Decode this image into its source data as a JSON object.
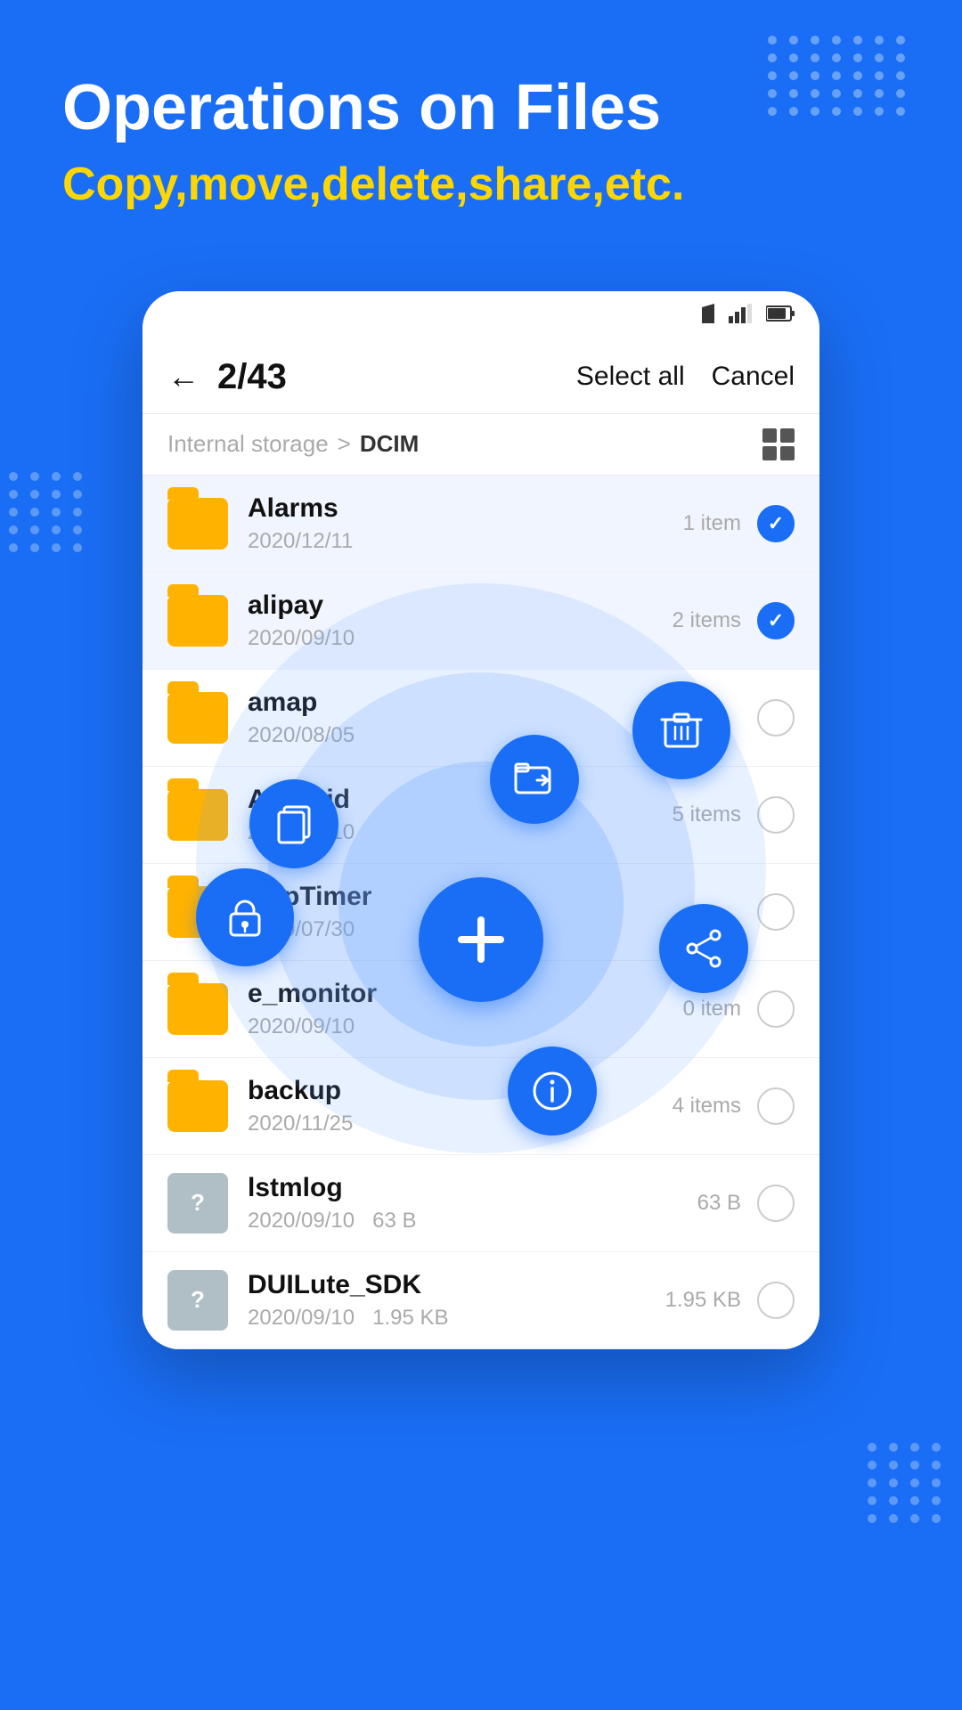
{
  "page": {
    "background_color": "#1a6ef5",
    "title": "Operations on Files",
    "subtitle": "Copy,move,delete,share,etc."
  },
  "status_bar": {
    "wifi_icon": "wifi",
    "signal_icon": "signal",
    "battery_icon": "battery"
  },
  "nav": {
    "back_label": "←",
    "selection_count": "2/43",
    "select_all_label": "Select all",
    "cancel_label": "Cancel"
  },
  "breadcrumb": {
    "root": "Internal storage",
    "separator": ">",
    "current": "DCIM"
  },
  "files": [
    {
      "id": 1,
      "name": "Alarms",
      "date": "2020/12/11",
      "meta": "1 item",
      "type": "folder",
      "selected": true
    },
    {
      "id": 2,
      "name": "alipay",
      "date": "2020/09/10",
      "meta": "2 items",
      "type": "folder",
      "selected": true
    },
    {
      "id": 3,
      "name": "amap",
      "date": "2020/08/05",
      "meta": "",
      "type": "folder",
      "selected": false
    },
    {
      "id": 4,
      "name": "Android",
      "date": "2020/09/10",
      "meta": "5 items",
      "type": "folder",
      "selected": false
    },
    {
      "id": 5,
      "name": "AppTimer",
      "date": "2020/07/30",
      "meta": "",
      "type": "folder",
      "selected": false
    },
    {
      "id": 6,
      "name": "e_monitor",
      "date": "2020/09/10",
      "meta": "0 item",
      "type": "folder",
      "selected": false
    },
    {
      "id": 7,
      "name": "backup",
      "date": "2020/11/25",
      "meta": "4 items",
      "type": "folder",
      "selected": false
    },
    {
      "id": 8,
      "name": "lstmlog",
      "date": "2020/09/10",
      "size": "63 B",
      "meta": "",
      "type": "file",
      "selected": false
    },
    {
      "id": 9,
      "name": "DUILute_SDK",
      "date": "2020/09/10",
      "size": "1.95 KB",
      "meta": "",
      "type": "file",
      "selected": false
    }
  ],
  "fab": {
    "main_icon": "+",
    "actions": {
      "copy_label": "copy",
      "move_label": "move",
      "delete_label": "delete",
      "share_label": "share",
      "lock_label": "lock",
      "info_label": "info"
    }
  }
}
